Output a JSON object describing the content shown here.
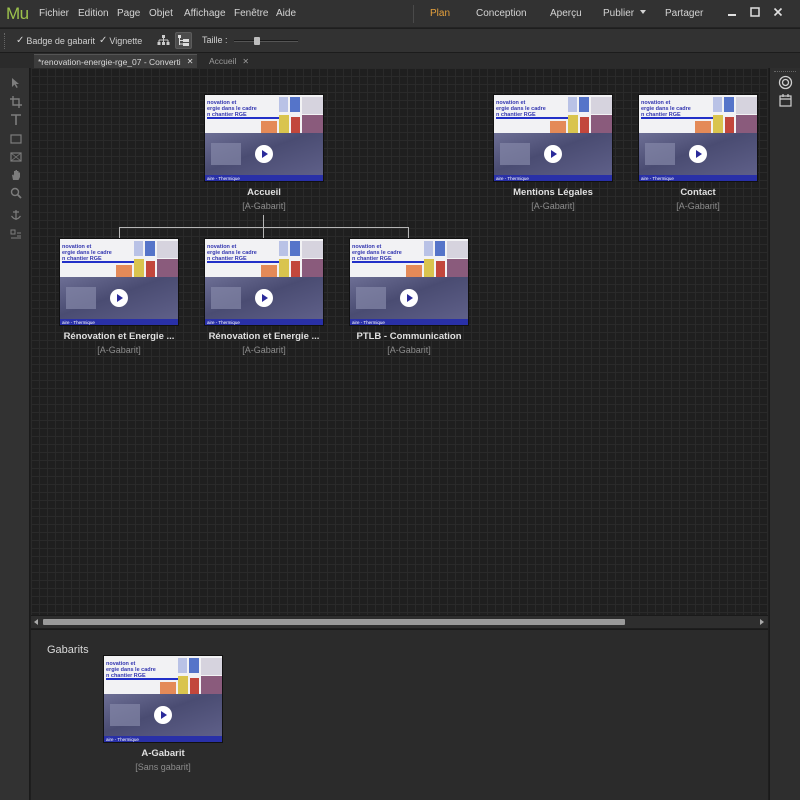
{
  "app": {
    "logo": "Mu"
  },
  "menu": [
    "Fichier",
    "Edition",
    "Page",
    "Objet",
    "Affichage",
    "Fenêtre",
    "Aide"
  ],
  "modes": [
    {
      "label": "Plan",
      "active": true
    },
    {
      "label": "Conception",
      "active": false
    },
    {
      "label": "Aperçu",
      "active": false
    },
    {
      "label": "Publier",
      "active": false
    },
    {
      "label": "Partager",
      "active": false
    }
  ],
  "toolbar": {
    "badge_checkbox": {
      "label": "Badge de gabarit",
      "checked": true
    },
    "thumb_checkbox": {
      "label": "Vignette",
      "checked": true
    },
    "size_label": "Taille :",
    "size_slider_fraction": 0.35
  },
  "tabs": [
    {
      "label": "*renovation-energie-rge_07 - Converti",
      "active": true
    },
    {
      "label": "Accueil",
      "active": false
    }
  ],
  "thumbnail": {
    "headline": "novation et\nergie dans le cadre\nn chantier RGE",
    "footer": "aire - Thermique"
  },
  "plan": {
    "pages": [
      {
        "name": "Accueil",
        "master": "[A-Gabarit]",
        "footer": "aire - Thermique"
      },
      {
        "name": "Mentions Légales",
        "master": "[A-Gabarit]",
        "footer": "aire - Thermique"
      },
      {
        "name": "Contact",
        "master": "[A-Gabarit]",
        "footer": "aire - Thermique"
      },
      {
        "name": "Rénovation et Energie ...",
        "master": "[A-Gabarit]",
        "footer": "aire - Thermique"
      },
      {
        "name": "Rénovation et Energie ...",
        "master": "[A-Gabarit]",
        "footer": "aire - Thermique"
      },
      {
        "name": "PTLB - Communication",
        "master": "[A-Gabarit]",
        "footer": "aire - Thermique"
      }
    ]
  },
  "masters": {
    "title": "Gabarits",
    "items": [
      {
        "name": "A-Gabarit",
        "master": "[Sans gabarit]",
        "footer": "aire - Thermique"
      }
    ]
  },
  "colors": {
    "accent": "#e5a03c",
    "logo": "#9cc24c",
    "thumb_blue": "#2930a8"
  }
}
